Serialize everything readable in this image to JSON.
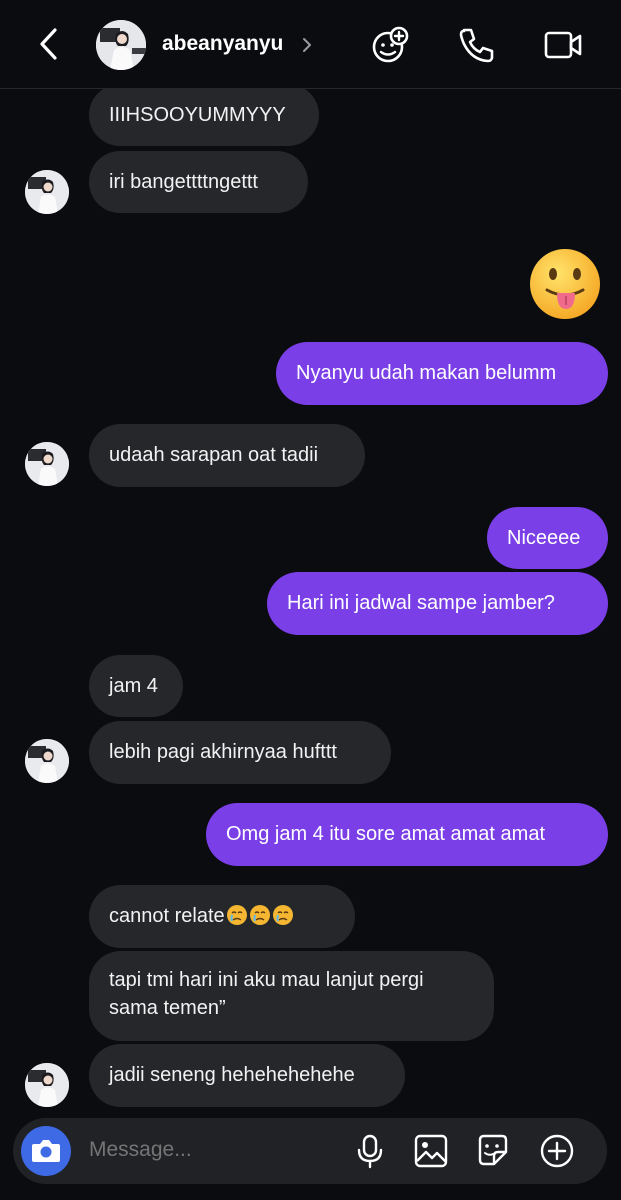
{
  "header": {
    "username": "abeanyanyu",
    "icons": [
      "back-chevron",
      "avatar",
      "effects-icon",
      "phone-icon",
      "video-camera-icon"
    ]
  },
  "messages": [
    {
      "side": "in",
      "text": "IIIHSOOYUMMYYY"
    },
    {
      "side": "in",
      "text": "iri bangettttngettt"
    },
    {
      "side": "out",
      "emoji": "tongue-out-face"
    },
    {
      "side": "out",
      "text": "Nyanyu udah makan belumm"
    },
    {
      "side": "in",
      "text": "udaah sarapan oat tadii"
    },
    {
      "side": "out",
      "text": "Niceeee"
    },
    {
      "side": "out",
      "text": "Hari ini jadwal sampe jamber?"
    },
    {
      "side": "in",
      "text": "jam 4"
    },
    {
      "side": "in",
      "text": "lebih pagi akhirnyaa hufttt"
    },
    {
      "side": "out",
      "text": "Omg jam 4 itu sore amat amat amat"
    },
    {
      "side": "in",
      "text": "cannot relate",
      "emojis": [
        "crying-face",
        "crying-face",
        "crying-face"
      ]
    },
    {
      "side": "in",
      "lines": [
        "tapi tmi hari ini aku mau lanjut pergi",
        "sama temen”"
      ]
    },
    {
      "side": "in",
      "text": "jadii seneng hehehehehehe"
    }
  ],
  "composer": {
    "placeholder": "Message...",
    "icons": [
      "camera-icon",
      "microphone-icon",
      "gallery-icon",
      "sticker-icon",
      "plus-icon"
    ]
  },
  "colors": {
    "background": "#0b0c10",
    "incoming_bubble": "#25272b",
    "outgoing_bubble": "#7b3fe8",
    "camera_button": "#3e6ae6"
  }
}
